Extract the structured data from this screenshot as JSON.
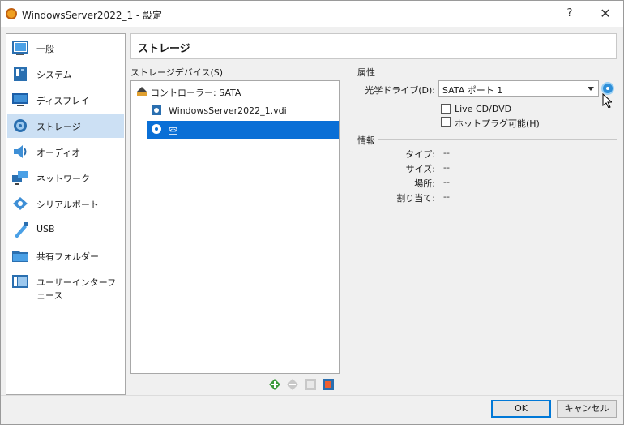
{
  "window": {
    "title": "WindowsServer2022_1 - 設定",
    "help_label": "?",
    "close_label": "✕"
  },
  "sidebar": {
    "items": [
      {
        "label": "一般",
        "icon": "general-icon"
      },
      {
        "label": "システム",
        "icon": "system-icon"
      },
      {
        "label": "ディスプレイ",
        "icon": "display-icon"
      },
      {
        "label": "ストレージ",
        "icon": "storage-icon",
        "selected": true
      },
      {
        "label": "オーディオ",
        "icon": "audio-icon"
      },
      {
        "label": "ネットワーク",
        "icon": "network-icon"
      },
      {
        "label": "シリアルポート",
        "icon": "serial-port-icon"
      },
      {
        "label": "USB",
        "icon": "usb-icon"
      },
      {
        "label": "共有フォルダー",
        "icon": "shared-folder-icon"
      },
      {
        "label": "ユーザーインターフェース",
        "icon": "user-interface-icon"
      }
    ]
  },
  "page": {
    "title": "ストレージ"
  },
  "storage_devices": {
    "group_label": "ストレージデバイス(S)",
    "tree": [
      {
        "label": "コントローラー: SATA",
        "icon": "controller-icon"
      },
      {
        "label": "WindowsServer2022_1.vdi",
        "icon": "hard-disk-icon"
      },
      {
        "label": "空",
        "icon": "optical-disc-icon",
        "selected": true
      }
    ],
    "tools": [
      "add-controller-icon",
      "remove-controller-icon",
      "add-attachment-icon",
      "remove-attachment-icon"
    ]
  },
  "attributes": {
    "group_label": "属性",
    "optical_drive_label": "光学ドライブ(D):",
    "optical_drive_value": "SATA ポート 1",
    "live_cd_label": "Live CD/DVD",
    "hotplug_label": "ホットプラグ可能(H)",
    "live_cd_checked": false,
    "hotplug_checked": false
  },
  "information": {
    "group_label": "情報",
    "rows": [
      {
        "label": "タイプ:",
        "value": "--"
      },
      {
        "label": "サイズ:",
        "value": "--"
      },
      {
        "label": "場所:",
        "value": "--"
      },
      {
        "label": "割り当て:",
        "value": "--"
      }
    ]
  },
  "footer": {
    "ok_label": "OK",
    "cancel_label": "キャンセル"
  },
  "colors": {
    "selection": "#0a6fd6",
    "sidebar_selection": "#cce0f4",
    "accent": "#0078d7"
  }
}
